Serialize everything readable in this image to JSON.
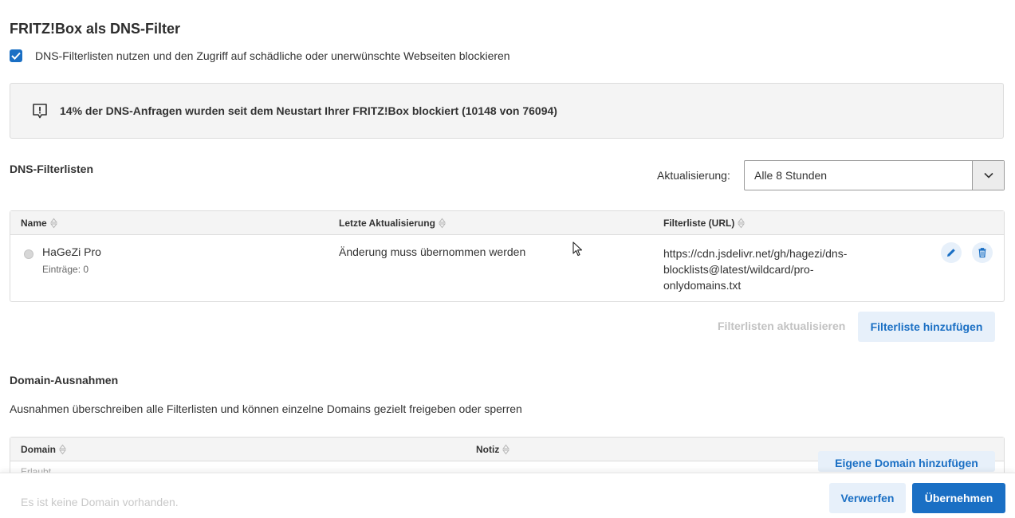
{
  "page": {
    "title": "FRITZ!Box als DNS-Filter",
    "checkbox_label": "DNS-Filterlisten nutzen und den Zugriff auf schädliche oder unerwünschte Webseiten blockieren",
    "checkbox_checked": true,
    "info_text": "14% der DNS-Anfragen wurden seit dem Neustart Ihrer FRITZ!Box blockiert (10148 von 76094)"
  },
  "filterlists": {
    "section_title": "DNS-Filterlisten",
    "update_label": "Aktualisierung:",
    "update_value": "Alle 8 Stunden",
    "columns": [
      "Name",
      "Letzte Aktualisierung",
      "Filterliste (URL)"
    ],
    "rows": [
      {
        "name": "HaGeZi Pro",
        "entries": "Einträge: 0",
        "last_update": "Änderung muss übernommen werden",
        "url_lines": [
          "https://cdn.jsdelivr.net/gh/hagezi/dns-",
          "blocklists@latest/wildcard/pro-",
          "onlydomains.txt"
        ],
        "edit_icon": "pencil-icon",
        "delete_icon": "trash-icon"
      }
    ],
    "refresh_label": "Filterlisten aktualisieren",
    "add_label": "Filterliste hinzufügen"
  },
  "exceptions": {
    "section_title": "Domain-Ausnahmen",
    "description": "Ausnahmen überschreiben alle Filterlisten und können einzelne Domains gezielt freigeben oder sperren",
    "columns": [
      "Domain",
      "Notiz"
    ],
    "group_label": "Erlaubt",
    "empty_text": "Es ist keine Domain vorhanden.",
    "add_label": "Eigene Domain hinzufügen"
  },
  "footer": {
    "discard_label": "Verwerfen",
    "apply_label": "Übernehmen"
  },
  "colors": {
    "accent": "#1a6fc4",
    "accent_light": "#e7f0fa",
    "header_bg": "#f4f4f4"
  }
}
